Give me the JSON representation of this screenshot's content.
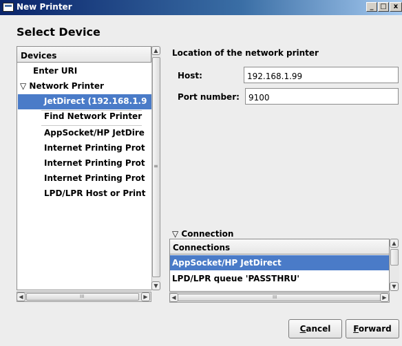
{
  "window": {
    "title": "New Printer",
    "controls": {
      "minimize": "_",
      "maximize": "□",
      "close": "x"
    }
  },
  "heading": "Select Device",
  "devices": {
    "header": "Devices",
    "items": [
      {
        "label": "Enter URI",
        "indent": 0,
        "selected": false
      },
      {
        "label": "▽ Network Printer",
        "indent": 0,
        "selected": false
      },
      {
        "label": "JetDirect (192.168.1.9",
        "indent": 1,
        "selected": true
      },
      {
        "label": "Find Network Printer",
        "indent": 1,
        "selected": false
      },
      {
        "label": "AppSocket/HP JetDire",
        "indent": 1,
        "selected": false
      },
      {
        "label": "Internet Printing Prot",
        "indent": 1,
        "selected": false
      },
      {
        "label": "Internet Printing Prot",
        "indent": 1,
        "selected": false
      },
      {
        "label": "Internet Printing Prot",
        "indent": 1,
        "selected": false
      },
      {
        "label": "LPD/LPR Host or Print",
        "indent": 1,
        "selected": false
      }
    ],
    "hscroll_grip": "III"
  },
  "location": {
    "label": "Location of the network printer",
    "host_label": "Host:",
    "host_value": "192.168.1.99",
    "port_label": "Port number:",
    "port_value": "9100"
  },
  "connection": {
    "expander_label": "▽ Connection",
    "header": "Connections",
    "items": [
      {
        "label": "AppSocket/HP JetDirect",
        "selected": true
      },
      {
        "label": "LPD/LPR queue 'PASSTHRU'",
        "selected": false
      }
    ],
    "hscroll_grip": "III"
  },
  "buttons": {
    "cancel": {
      "accel": "C",
      "rest": "ancel"
    },
    "forward": {
      "accel": "F",
      "rest": "orward"
    }
  },
  "colors": {
    "selection": "#4a7bc8",
    "titlebar_start": "#0a246a"
  }
}
